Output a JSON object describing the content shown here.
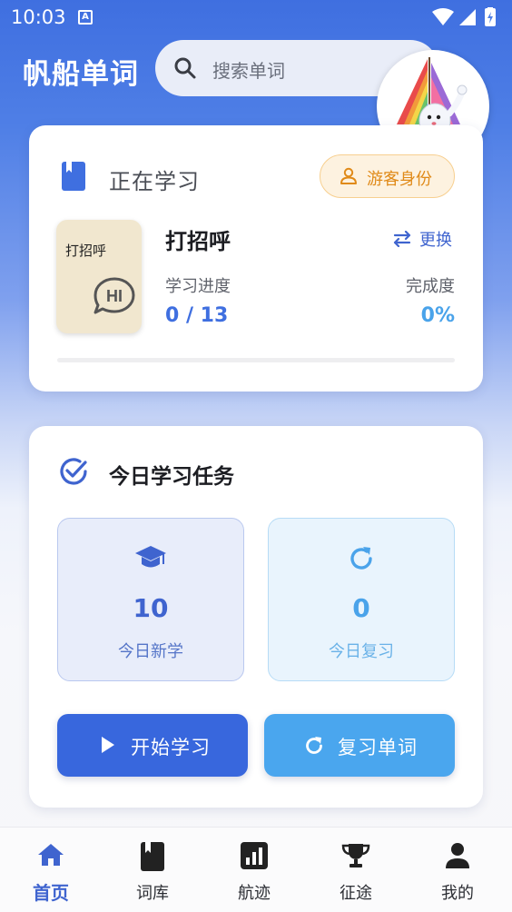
{
  "status_bar": {
    "time": "10:03",
    "notification_icon": "A"
  },
  "header": {
    "app_title": "帆船单词",
    "search_placeholder": "搜索单词",
    "avatar_icon": "sailboat-mascot-avatar"
  },
  "current_study": {
    "heading": "正在学习",
    "guest_badge": "游客身份",
    "book": {
      "cover_title": "打招呼",
      "cover_icon_text": "HI",
      "name": "打招呼"
    },
    "switch_label": "更换",
    "progress_label": "学习进度",
    "progress_value": "0 / 13",
    "completion_label": "完成度",
    "completion_value": "0%",
    "completion_fraction": 0
  },
  "daily_tasks": {
    "title": "今日学习任务",
    "new_words": {
      "count": "10",
      "label": "今日新学"
    },
    "review": {
      "count": "0",
      "label": "今日复习"
    },
    "start_button": "开始学习",
    "review_button": "复习单词"
  },
  "bottom_nav": {
    "items": [
      {
        "label": "首页",
        "icon": "home-icon",
        "active": true
      },
      {
        "label": "词库",
        "icon": "book-icon",
        "active": false
      },
      {
        "label": "航迹",
        "icon": "chart-icon",
        "active": false
      },
      {
        "label": "征途",
        "icon": "trophy-icon",
        "active": false
      },
      {
        "label": "我的",
        "icon": "person-icon",
        "active": false
      }
    ]
  },
  "colors": {
    "primary": "#3f6fe0",
    "accent_light_blue": "#4aa3ea",
    "guest_orange": "#e08a18"
  }
}
